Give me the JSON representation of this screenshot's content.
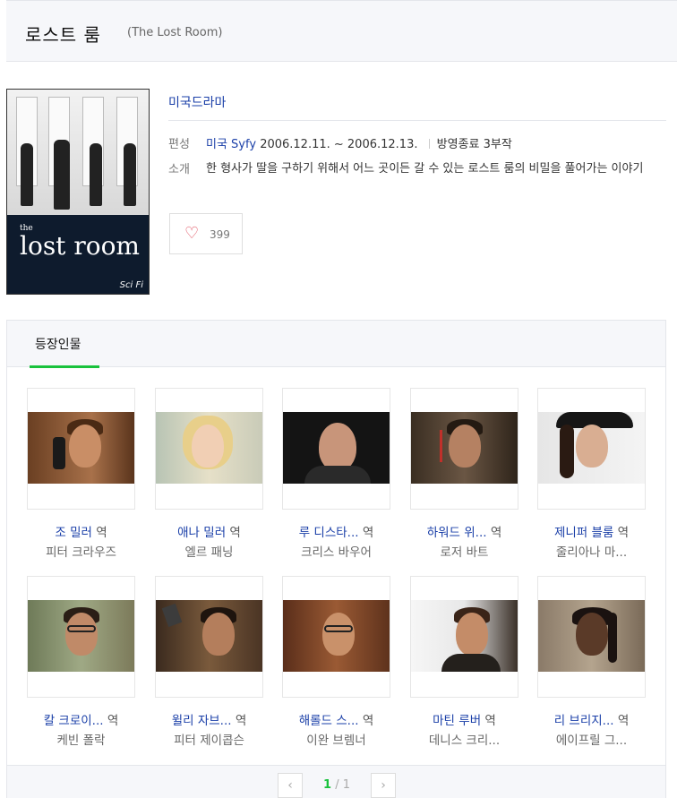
{
  "header": {
    "title": "로스트 룸",
    "subtitle": "(The Lost Room)"
  },
  "poster": {
    "title_small": "the",
    "title": "lost room",
    "network": "Sci Fi"
  },
  "info": {
    "genre": "미국드라마",
    "broadcast_label": "편성",
    "broadcast_channel": "미국 Syfy",
    "broadcast_dates": "2006.12.11. ~ 2006.12.13.",
    "status": "방영종료 3부작",
    "synopsis_label": "소개",
    "synopsis": "한 형사가 딸을 구하기 위해서 어느 곳이든 갈 수 있는 로스트 룸의 비밀을 풀어가는 이야기"
  },
  "like": {
    "icon": "heart-icon",
    "count": "399"
  },
  "cast": {
    "tab_label": "등장인물",
    "role_suffix": "역",
    "members": [
      {
        "role": "조 밀러",
        "actor": "피터 크라우즈"
      },
      {
        "role": "애나 밀러",
        "actor": "엘르 패닝"
      },
      {
        "role": "루 디스타...",
        "actor": "크리스 바우어"
      },
      {
        "role": "하워드 위...",
        "actor": "로저 바트"
      },
      {
        "role": "제니퍼 블룸",
        "actor": "줄리아나 마..."
      },
      {
        "role": "칼 크로이...",
        "actor": "케빈 폴락"
      },
      {
        "role": "윌리 자브...",
        "actor": "피터 제이콥슨"
      },
      {
        "role": "해롤드 스...",
        "actor": "이완 브렘너"
      },
      {
        "role": "마틴 루버",
        "actor": "데니스 크리..."
      },
      {
        "role": "리 브리지...",
        "actor": "에이프릴 그..."
      }
    ]
  },
  "pager": {
    "current": "1",
    "separator": "/",
    "total": "1",
    "prev": "‹",
    "next": "›"
  }
}
